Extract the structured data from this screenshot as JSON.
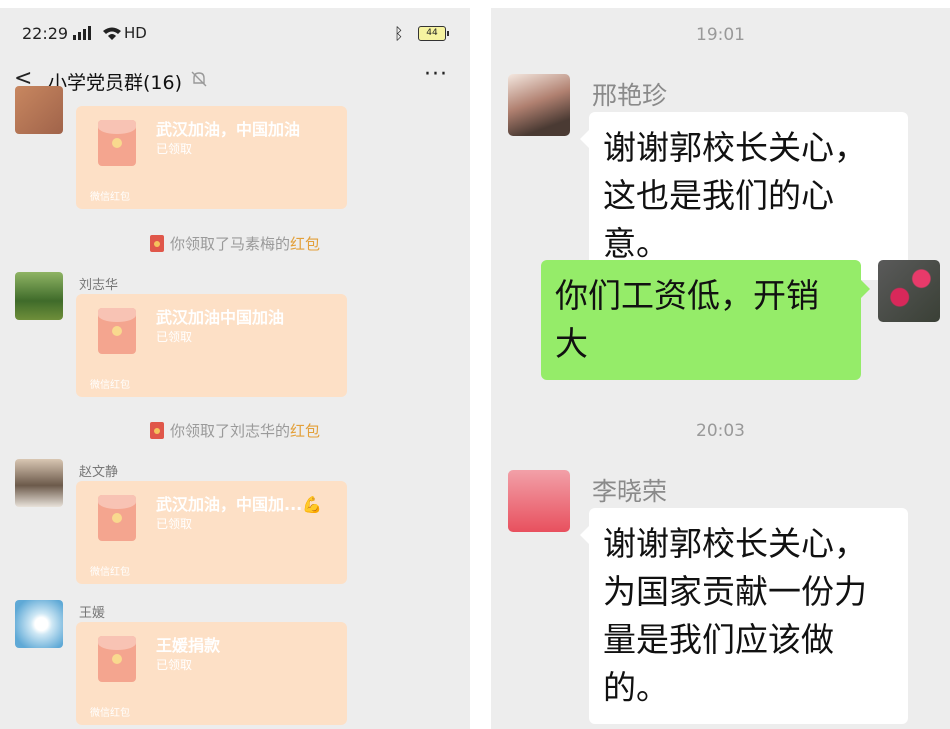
{
  "left": {
    "status": {
      "time": "22:29",
      "network": "HD",
      "battery": "44"
    },
    "header": {
      "back_label": "<",
      "title": "小学党员群(16)",
      "more_label": "···"
    },
    "messages": [
      {
        "sender": "",
        "title": "武汉加油，中国加油",
        "state": "已领取",
        "label": "微信红包"
      },
      {
        "sender": "刘志华",
        "title": "武汉加油中国加油",
        "state": "已领取",
        "label": "微信红包"
      },
      {
        "sender": "赵文静",
        "title": "武汉加油，中国加...💪",
        "state": "已领取",
        "label": "微信红包"
      },
      {
        "sender": "王媛",
        "title": "王媛捐款",
        "state": "已领取",
        "label": "微信红包"
      }
    ],
    "system": [
      {
        "prefix": "你领取了马素梅的",
        "highlight": "红包"
      },
      {
        "prefix": "你领取了刘志华的",
        "highlight": "红包"
      }
    ]
  },
  "right": {
    "time1": "19:01",
    "sender1": "邢艳珍",
    "msg1_line1": "谢谢郭校长关心，",
    "msg1_line2": "这也是我们的心意。",
    "self_line1": "你们工资低，开销",
    "self_line2": "大",
    "time2": "20:03",
    "sender2": "李晓荣",
    "msg2_line1": "谢谢郭校长关心，",
    "msg2_line2": "为国家贡献一份力",
    "msg2_line3": "量是我们应该做的。"
  },
  "colors": {
    "bg": "#ededed",
    "red_packet": "#fde0c6",
    "self_bubble": "#95ec69",
    "highlight": "#e3a03a"
  }
}
